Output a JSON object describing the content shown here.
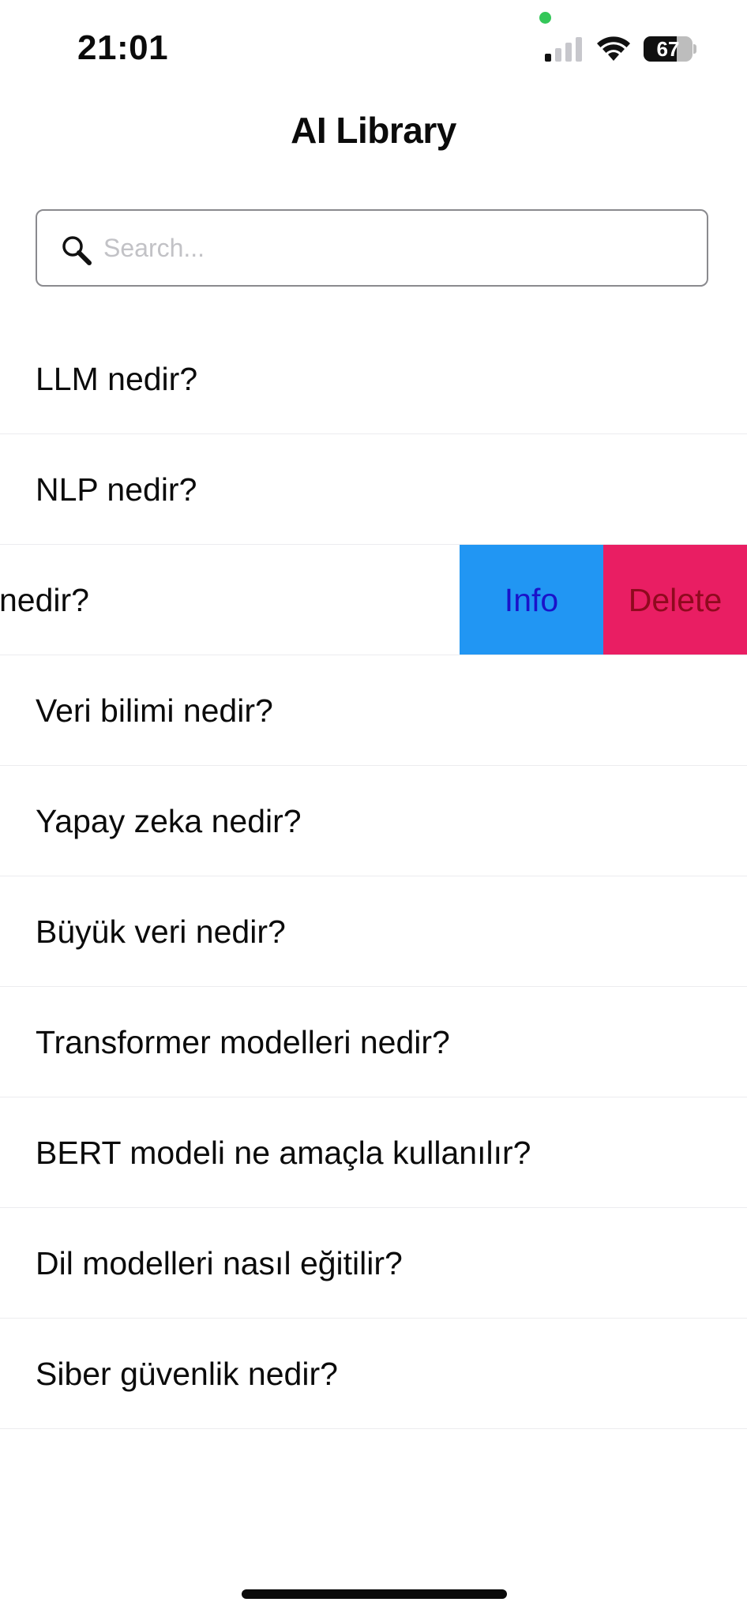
{
  "status_bar": {
    "time": "21:01",
    "battery_level": "67",
    "battery_fraction": 0.67,
    "signal_bars_active": 1,
    "signal_bars_total": 4,
    "indicator_color": "#34c759"
  },
  "header": {
    "title": "AI Library"
  },
  "search": {
    "placeholder": "Search...",
    "value": "",
    "icon": "search-icon"
  },
  "list": {
    "items": [
      {
        "label": "LLM nedir?"
      },
      {
        "label": "NLP nedir?"
      },
      {
        "label": "Chatbot nedir?",
        "visible_label": "nedir?",
        "swiped": true
      },
      {
        "label": "Veri bilimi nedir?"
      },
      {
        "label": "Yapay zeka nedir?"
      },
      {
        "label": "Büyük veri nedir?"
      },
      {
        "label": "Transformer modelleri nedir?"
      },
      {
        "label": "BERT modeli ne amaçla kullanılır?"
      },
      {
        "label": "Dil modelleri nasıl eğitilir?"
      },
      {
        "label": "Siber güvenlik nedir?"
      }
    ]
  },
  "swipe_actions": {
    "info_label": "Info",
    "delete_label": "Delete",
    "info_color": "#2196f3",
    "delete_color": "#e91e63"
  }
}
